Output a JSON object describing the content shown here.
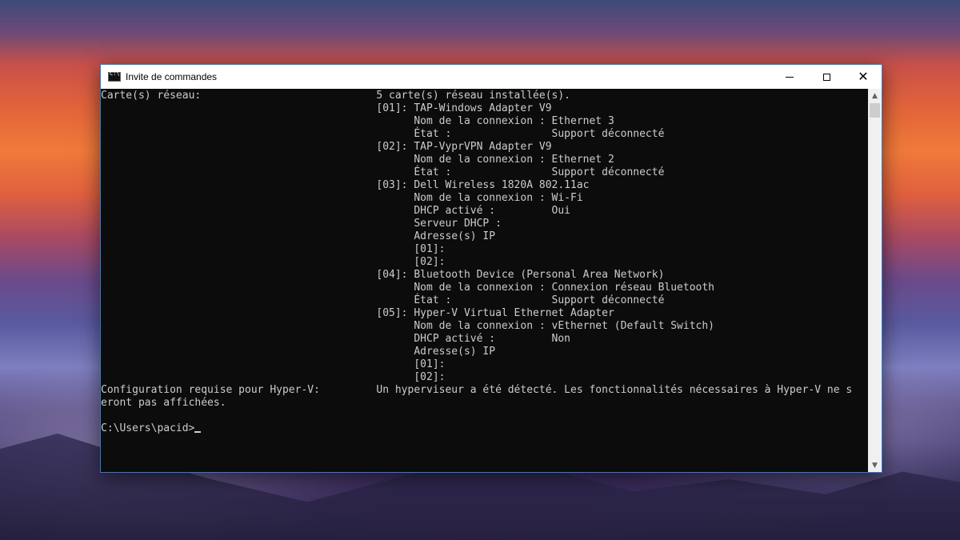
{
  "window": {
    "title": "Invite de commandes",
    "controls": {
      "minimize": "minimize",
      "maximize": "maximize",
      "close": "close"
    }
  },
  "console": {
    "lines": [
      "Carte(s) réseau:                            5 carte(s) réseau installée(s).",
      "                                            [01]: TAP-Windows Adapter V9",
      "                                                  Nom de la connexion : Ethernet 3",
      "                                                  État :                Support déconnecté",
      "                                            [02]: TAP-VyprVPN Adapter V9",
      "                                                  Nom de la connexion : Ethernet 2",
      "                                                  État :                Support déconnecté",
      "                                            [03]: Dell Wireless 1820A 802.11ac",
      "                                                  Nom de la connexion : Wi-Fi",
      "                                                  DHCP activé :         Oui",
      "                                                  Serveur DHCP :",
      "                                                  Adresse(s) IP",
      "                                                  [01]:",
      "                                                  [02]:",
      "                                            [04]: Bluetooth Device (Personal Area Network)",
      "                                                  Nom de la connexion : Connexion réseau Bluetooth",
      "                                                  État :                Support déconnecté",
      "                                            [05]: Hyper-V Virtual Ethernet Adapter",
      "                                                  Nom de la connexion : vEthernet (Default Switch)",
      "                                                  DHCP activé :         Non",
      "                                                  Adresse(s) IP",
      "                                                  [01]:",
      "                                                  [02]:",
      "Configuration requise pour Hyper-V:         Un hyperviseur a été détecté. Les fonctionnalités nécessaires à Hyper-V ne s",
      "eront pas affichées.",
      ""
    ],
    "prompt": "C:\\Users\\pacid>"
  },
  "colors": {
    "console_bg": "#0c0c0c",
    "console_text": "#cccccc",
    "titlebar_bg": "#ffffff",
    "window_border": "#2b7bd6"
  },
  "icons": [
    "cmd-app-icon",
    "minimize-icon",
    "maximize-icon",
    "close-icon",
    "scroll-up-icon",
    "scroll-down-icon"
  ]
}
